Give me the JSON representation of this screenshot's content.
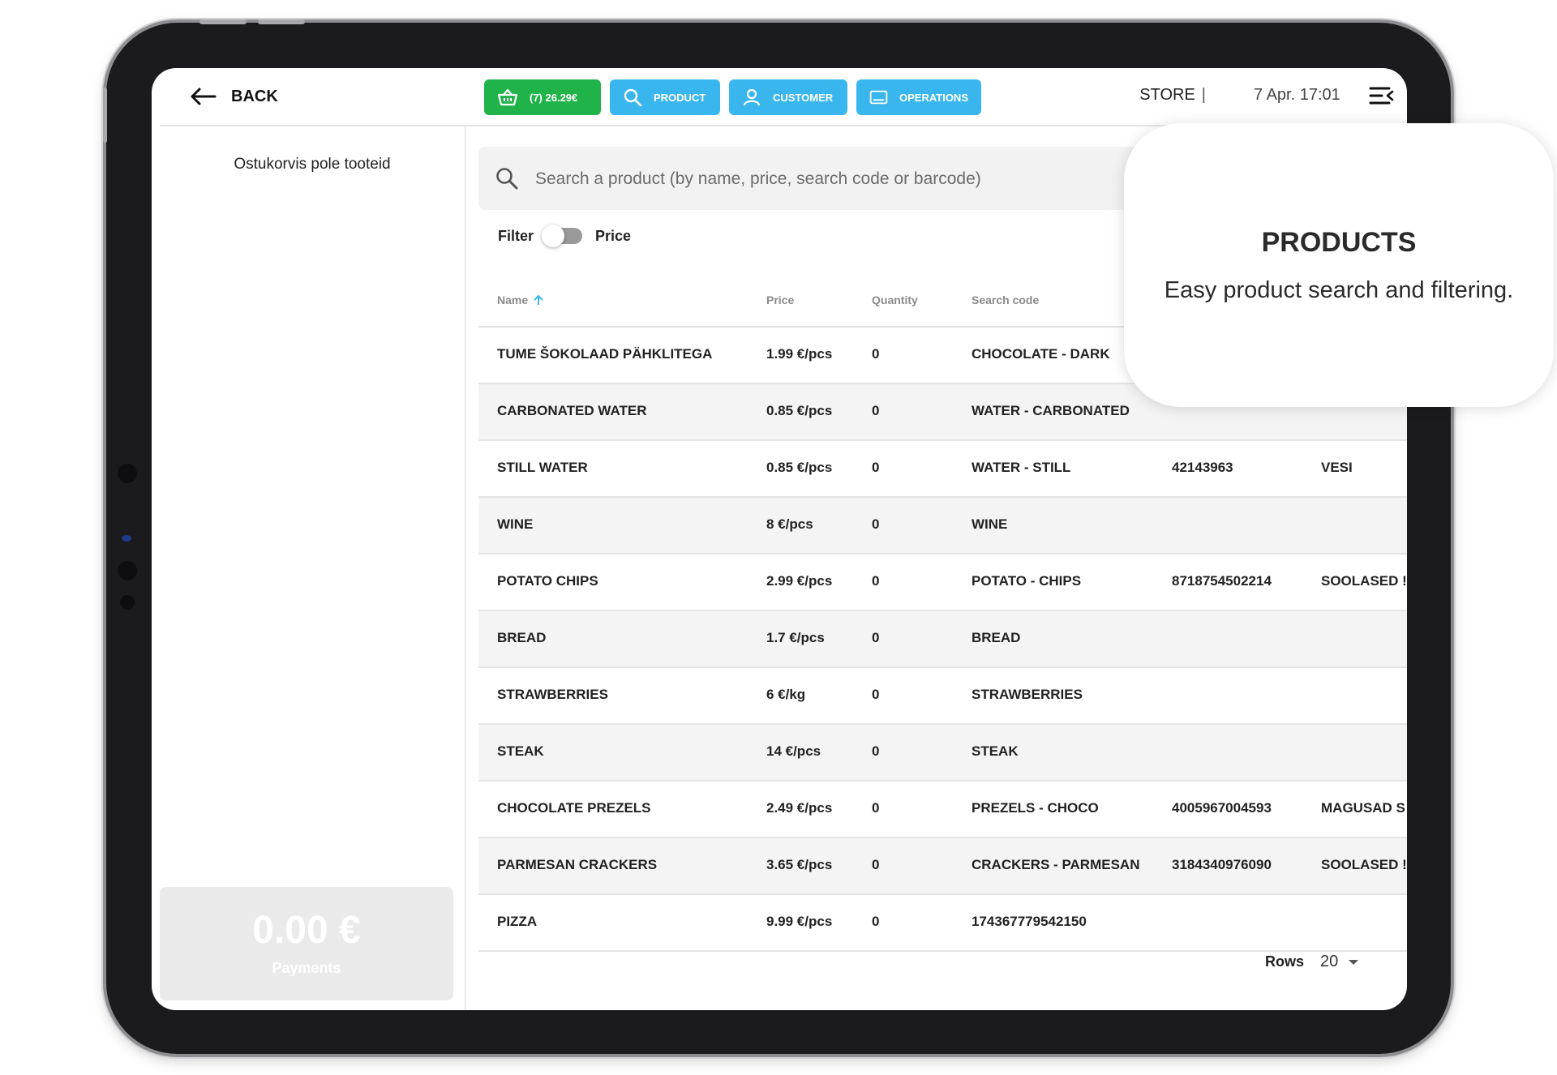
{
  "header": {
    "back_label": "BACK",
    "cart_label": "(7) 26.29€",
    "product_label": "PRODUCT",
    "customer_label": "CUSTOMER",
    "operations_label": "OPERATIONS",
    "store_label": "STORE",
    "datetime": "7 Apr. 17:01"
  },
  "cart": {
    "empty_message": "Ostukorvis pole tooteid",
    "total": "0.00 €",
    "payments_label": "Payments"
  },
  "search": {
    "placeholder": "Search a product (by name, price, search code or barcode)"
  },
  "filter": {
    "label": "Filter",
    "price_label": "Price",
    "price_enabled": false
  },
  "table": {
    "columns": [
      "Name",
      "Price",
      "Quantity",
      "Search code"
    ],
    "rows": [
      {
        "name": "TUME ŠOKOLAAD PÄHKLITEGA",
        "price": "1.99 €/pcs",
        "qty": "0",
        "code": "CHOCOLATE - DARK",
        "barcode": "",
        "group": ""
      },
      {
        "name": "CARBONATED WATER",
        "price": "0.85 €/pcs",
        "qty": "0",
        "code": "WATER - CARBONATED",
        "barcode": "",
        "group": ""
      },
      {
        "name": "STILL WATER",
        "price": "0.85 €/pcs",
        "qty": "0",
        "code": "WATER - STILL",
        "barcode": "42143963",
        "group": "VESI"
      },
      {
        "name": "WINE",
        "price": "8 €/pcs",
        "qty": "0",
        "code": "WINE",
        "barcode": "",
        "group": ""
      },
      {
        "name": "POTATO CHIPS",
        "price": "2.99 €/pcs",
        "qty": "0",
        "code": "POTATO - CHIPS",
        "barcode": "8718754502214",
        "group": "SOOLASED !"
      },
      {
        "name": "BREAD",
        "price": "1.7 €/pcs",
        "qty": "0",
        "code": "BREAD",
        "barcode": "",
        "group": ""
      },
      {
        "name": "STRAWBERRIES",
        "price": "6 €/kg",
        "qty": "0",
        "code": "STRAWBERRIES",
        "barcode": "",
        "group": ""
      },
      {
        "name": "STEAK",
        "price": "14 €/pcs",
        "qty": "0",
        "code": "STEAK",
        "barcode": "",
        "group": ""
      },
      {
        "name": "CHOCOLATE PREZELS",
        "price": "2.49 €/pcs",
        "qty": "0",
        "code": "PREZELS - CHOCO",
        "barcode": "4005967004593",
        "group": "MAGUSAD S"
      },
      {
        "name": "PARMESAN CRACKERS",
        "price": "3.65 €/pcs",
        "qty": "0",
        "code": "CRACKERS - PARMESAN",
        "barcode": "3184340976090",
        "group": "SOOLASED !"
      },
      {
        "name": "PIZZA",
        "price": "9.99 €/pcs",
        "qty": "0",
        "code": "174367779542150",
        "barcode": "",
        "group": ""
      }
    ]
  },
  "pagination": {
    "rows_label": "Rows",
    "rows_value": "20"
  },
  "promo_card": {
    "title": "PRODUCTS",
    "subtitle": "Easy product search and filtering."
  },
  "colors": {
    "cart_green": "#1fb34a",
    "accent_blue": "#3ab6ee"
  },
  "icons": [
    "arrow-left-icon",
    "basket-icon",
    "search-icon",
    "user-icon",
    "monitor-icon",
    "menu-collapse-icon",
    "sort-asc-icon",
    "chevron-down-icon"
  ]
}
